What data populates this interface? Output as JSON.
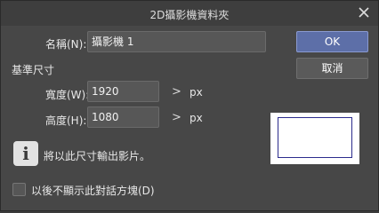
{
  "window": {
    "title": "2D攝影機資料夾"
  },
  "name_row": {
    "label": "名稱(N):",
    "value": "攝影機 1"
  },
  "section": {
    "title": "基準尺寸"
  },
  "width_row": {
    "label": "寬度(W):",
    "value": "1920",
    "spin": ">",
    "unit": "px"
  },
  "height_row": {
    "label": "高度(H):",
    "value": "1080",
    "spin": ">",
    "unit": "px"
  },
  "buttons": {
    "ok": "OK",
    "cancel": "取消"
  },
  "info": {
    "icon_glyph": "i",
    "message": "將以此尺寸輸出影片。"
  },
  "checkbox": {
    "label": "以後不顯示此對話方塊(D)",
    "checked": false
  },
  "icons": {
    "close": "close-icon",
    "info": "info-icon"
  },
  "colors": {
    "ok_button": "#5d6fa8",
    "preview_frame": "#2c2c8c"
  }
}
